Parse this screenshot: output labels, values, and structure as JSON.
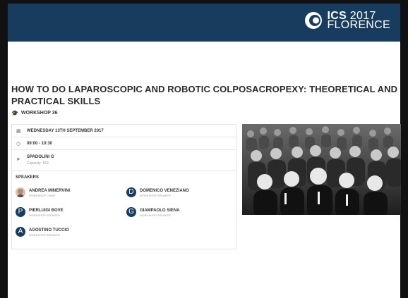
{
  "header": {
    "logo_ics": "ICS",
    "logo_year": "2017",
    "logo_city": "FLORENCE"
  },
  "session": {
    "title": "HOW TO DO LAPAROSCOPIC AND ROBOTIC COLPOSACROPEXY: THEORETICAL AND PRACTICAL SKILLS",
    "workshop_label": "WORKSHOP 36",
    "date": "WEDNESDAY 13TH SEPTEMBER 2017",
    "time": "09:00 - 10:30",
    "room": "SPADOLINI G",
    "capacity": "Capacity: 150"
  },
  "speakers": {
    "heading": "SPEAKERS",
    "items": [
      {
        "initial": "",
        "name": "ANDREA MINERVINI",
        "role": "WORKSHOP CHAIR"
      },
      {
        "initial": "D",
        "name": "DOMENICO VENEZIANO",
        "role": "WORKSHOP SPEAKER"
      },
      {
        "initial": "P",
        "name": "PIERLUIGI BOVE",
        "role": "WORKSHOP SPEAKER"
      },
      {
        "initial": "G",
        "name": "GIAMPAOLO SIENA",
        "role": "WORKSHOP SPEAKER"
      },
      {
        "initial": "A",
        "name": "AGOSTINO TUCCIO",
        "role": "WORKSHOP SPEAKER"
      }
    ]
  },
  "icons": {
    "workshop": "mortarboard-icon",
    "date": "calendar-icon",
    "time": "clock-icon",
    "room": "location-arrow-icon"
  },
  "colors": {
    "header_bg": "#183c5e",
    "avatar_bg": "#183c5e"
  }
}
